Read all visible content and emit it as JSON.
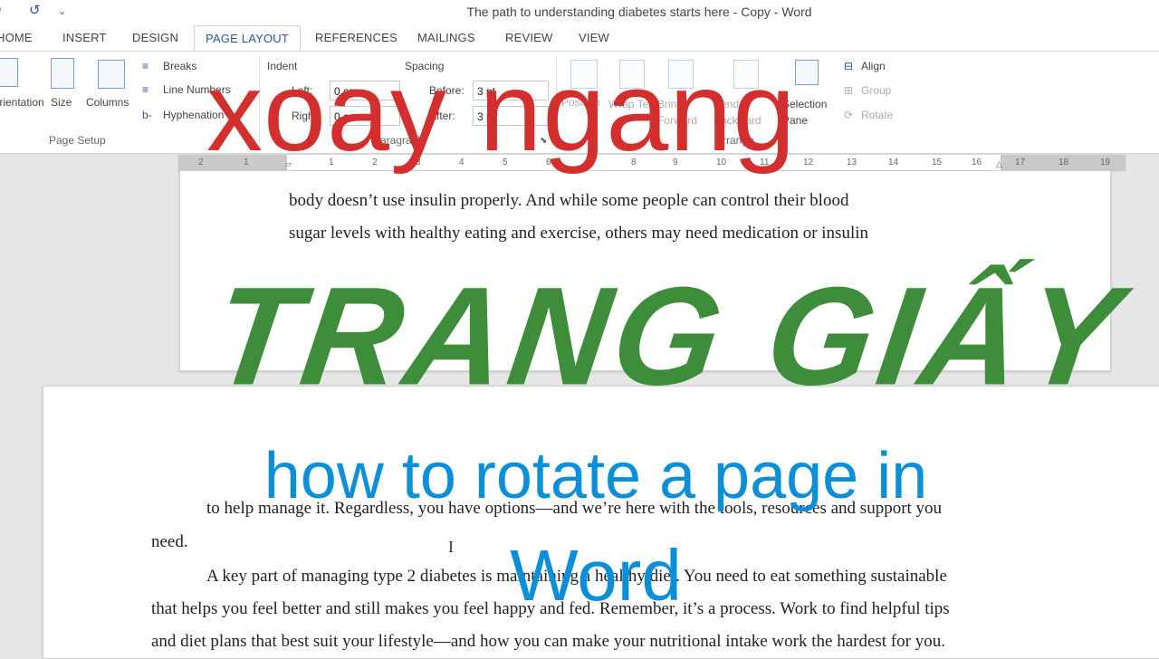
{
  "window": {
    "title": "The path to understanding diabetes starts here - Copy - Word",
    "quick_access": {
      "undo": "↺",
      "more": "⌄"
    }
  },
  "tabs": [
    "HOME",
    "INSERT",
    "DESIGN",
    "PAGE LAYOUT",
    "REFERENCES",
    "MAILINGS",
    "REVIEW",
    "VIEW"
  ],
  "active_tab": "PAGE LAYOUT",
  "ribbon": {
    "page_setup": {
      "orientation": "Orientation",
      "size": "Size",
      "columns": "Columns",
      "breaks": "Breaks",
      "line_numbers": "Line Numbers",
      "hyphenation": "Hyphenation",
      "group_label": "Page Setup"
    },
    "paragraph": {
      "indent_label": "Indent",
      "left_label": "Left:",
      "left_value": "0 cm",
      "right_label": "Right:",
      "right_value": "0 cm",
      "spacing_label": "Spacing",
      "before_label": "Before:",
      "before_value": "3 pt",
      "after_label": "After:",
      "after_value": "3 pt",
      "group_label": "Paragraph"
    },
    "arrange": {
      "position": "Position",
      "wrap_text": "Wrap Text",
      "bring_forward": "Bring Forward",
      "send_backward": "Send Backward",
      "selection_pane": "Selection Pane",
      "align": "Align",
      "group": "Group",
      "rotate": "Rotate",
      "group_label": "Arrange"
    }
  },
  "ruler": {
    "ticks": [
      "2",
      "1",
      "1",
      "2",
      "3",
      "4",
      "5",
      "6",
      "7",
      "8",
      "9",
      "10",
      "11",
      "12",
      "13",
      "14",
      "15",
      "16",
      "17",
      "18",
      "19"
    ]
  },
  "document": {
    "page1_lines": [
      "body doesn’t use insulin properly. And while some people can control their blood",
      "sugar levels with healthy eating and exercise, others may need medication or insulin"
    ],
    "page2_line1": "to help manage it. Regardless, you have options—and we’re here with the tools, resources and support you",
    "page2_line2": "need.",
    "page2_line3": "A key part of managing type 2 diabetes is maintaining a healthy diet. You need to eat something sustainable",
    "page2_line4": "that helps you feel better and still makes you feel happy and fed. Remember, it’s a process. Work to find helpful tips",
    "page2_line5": "and diet plans that best suit your lifestyle—and how you can make your nutritional intake work the hardest for you."
  },
  "overlay": {
    "line1": "xoay ngang",
    "line2": "TRANG GIẤY",
    "line3": "how to rotate a page in",
    "line4": "Word",
    "colors": {
      "red": "#d32f2f",
      "green": "#3d8d3a",
      "blue": "#0b8fd8"
    }
  }
}
